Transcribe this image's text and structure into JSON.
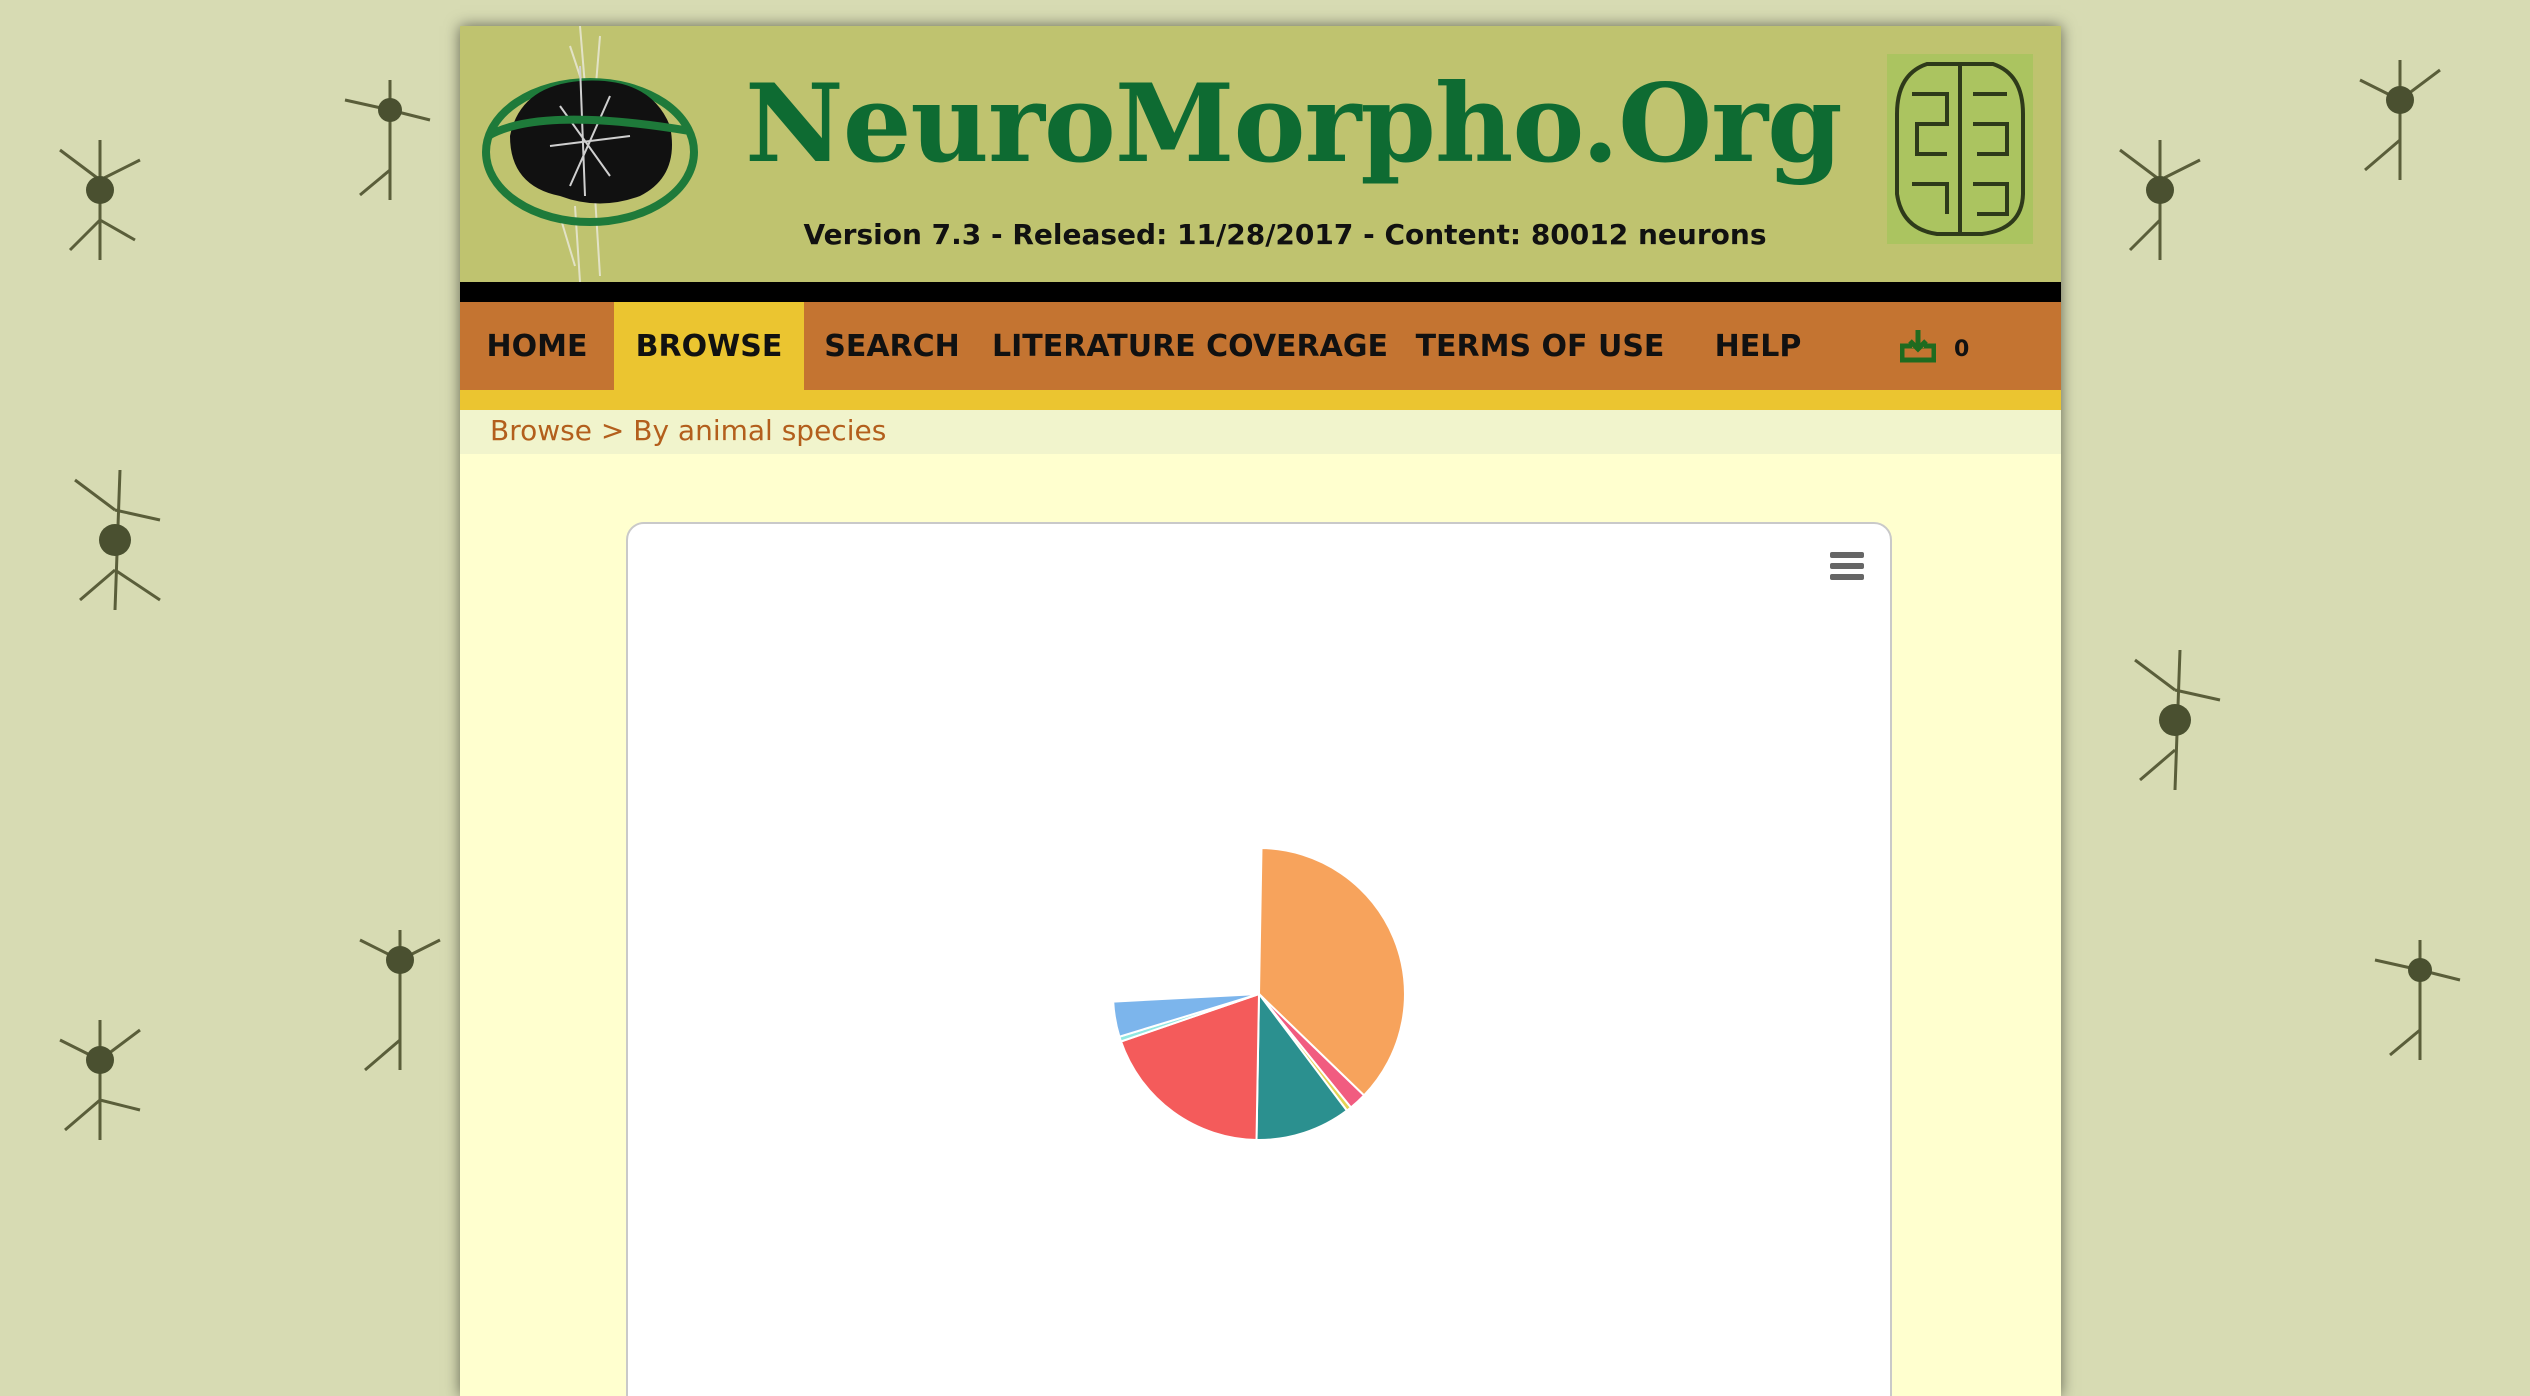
{
  "header": {
    "site_title": "NeuroMorpho.Org",
    "subtitle": "Version 7.3 - Released: 11/28/2017 - Content: 80012 neurons"
  },
  "nav": {
    "items": [
      {
        "label": "HOME",
        "active": false
      },
      {
        "label": "BROWSE",
        "active": true
      },
      {
        "label": "SEARCH",
        "active": false
      },
      {
        "label": "LITERATURE COVERAGE",
        "active": false
      },
      {
        "label": "TERMS OF USE",
        "active": false
      },
      {
        "label": "HELP",
        "active": false
      }
    ],
    "download_icon": "download-icon",
    "download_count": "0"
  },
  "breadcrumb": {
    "root": "Browse",
    "separator": ">",
    "current": "By animal species"
  },
  "chart": {
    "menu_icon": "hamburger-menu-icon"
  },
  "chart_data": {
    "type": "pie",
    "title": "",
    "state": "animating",
    "series": [
      {
        "values": [
          {
            "color": "#f7a35c",
            "start_deg": 1,
            "end_deg": 134
          },
          {
            "color": "#f15c80",
            "start_deg": 134,
            "end_deg": 141
          },
          {
            "color": "#e4d354",
            "start_deg": 141,
            "end_deg": 143
          },
          {
            "color": "#2b908f",
            "start_deg": 143,
            "end_deg": 181
          },
          {
            "color": "#f45b5b",
            "start_deg": 181,
            "end_deg": 251
          },
          {
            "color": "#91e8e1",
            "start_deg": 251,
            "end_deg": 253
          },
          {
            "color": "#7cb5ec",
            "start_deg": 253,
            "end_deg": 267
          }
        ]
      }
    ]
  }
}
